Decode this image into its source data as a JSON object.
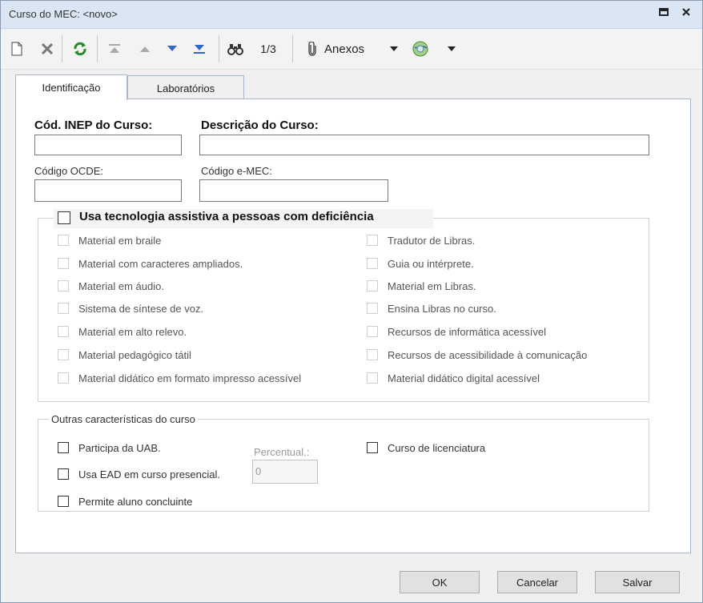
{
  "window": {
    "title": "Curso do MEC: <novo>"
  },
  "toolbar": {
    "record_position": "1/3",
    "attachments_label": "Anexos"
  },
  "tabs": [
    {
      "label": "Identificação"
    },
    {
      "label": "Laboratórios"
    }
  ],
  "fields": {
    "inep_label": "Cód. INEP do Curso:",
    "descricao_label": "Descrição do Curso:",
    "ocde_label": "Código OCDE:",
    "emec_label": "Código e-MEC:"
  },
  "assistive": {
    "title": "Usa tecnologia assistiva a pessoas com deficiência",
    "left": [
      "Material em braile",
      "Material com caracteres ampliados.",
      "Material em áudio.",
      "Sistema de síntese de voz.",
      "Material em alto relevo.",
      "Material pedagógico tátil",
      "Material didático em formato impresso acessível"
    ],
    "right": [
      "Tradutor de Libras.",
      "Guia ou intérprete.",
      "Material em Libras.",
      "Ensina Libras no curso.",
      "Recursos de informática acessível",
      "Recursos de acessibilidade à comunicação",
      "Material didático digital acessível"
    ]
  },
  "outras": {
    "title": "Outras características do curso",
    "uab": "Participa da UAB.",
    "ead": "Usa EAD em curso presencial.",
    "concluinte": "Permite aluno concluinte",
    "licenciatura": "Curso de licenciatura",
    "percentual_label": "Percentual.:",
    "percentual_value": "0"
  },
  "buttons": {
    "ok": "OK",
    "cancel": "Cancelar",
    "save": "Salvar"
  }
}
